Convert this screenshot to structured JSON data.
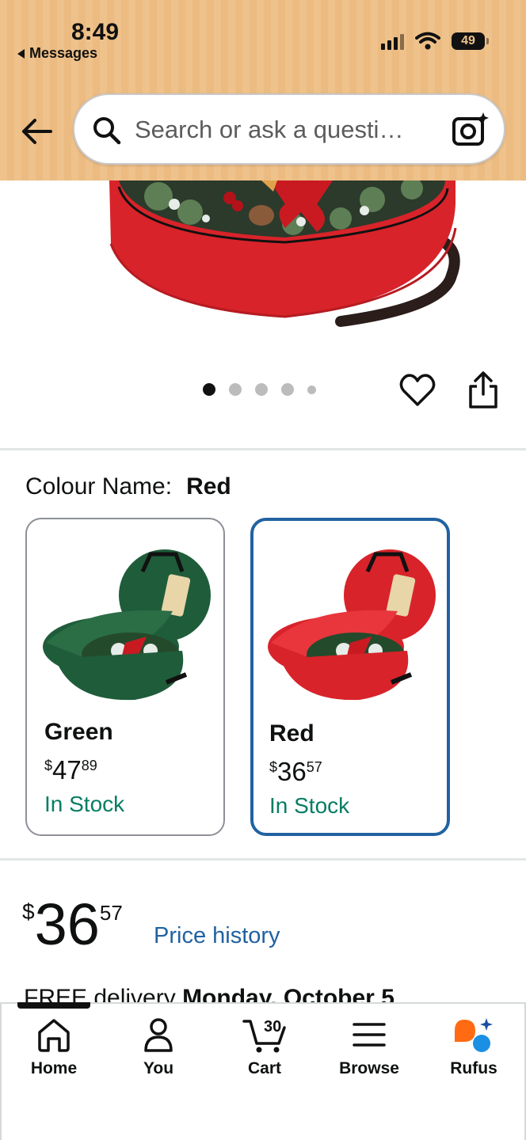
{
  "status_bar": {
    "time": "8:49",
    "back_app": "Messages",
    "battery": "49"
  },
  "header": {
    "search_placeholder": "Search or ask a questi…"
  },
  "carousel": {
    "total_images": 5,
    "active_index": 0
  },
  "colour": {
    "label": "Colour Name:",
    "selected": "Red",
    "options": [
      {
        "name": "Green",
        "currency": "$",
        "whole": "47",
        "cents": "89",
        "stock": "In Stock",
        "color": "#1f5c3a"
      },
      {
        "name": "Red",
        "currency": "$",
        "whole": "36",
        "cents": "57",
        "stock": "In Stock",
        "color": "#d8232a"
      }
    ]
  },
  "price": {
    "currency": "$",
    "whole": "36",
    "cents": "57",
    "history_link": "Price history"
  },
  "delivery": {
    "prefix": "FREE delivery",
    "date": "Monday, October 5"
  },
  "bottom_nav": {
    "items": [
      {
        "label": "Home",
        "icon": "home-icon"
      },
      {
        "label": "You",
        "icon": "person-icon"
      },
      {
        "label": "Cart",
        "icon": "cart-icon",
        "count": "30"
      },
      {
        "label": "Browse",
        "icon": "menu-icon"
      },
      {
        "label": "Rufus",
        "icon": "rufus-icon"
      }
    ]
  },
  "colors": {
    "accent_blue": "#2162a1",
    "stock_green": "#067d62",
    "header_orange": "#efc28b"
  }
}
